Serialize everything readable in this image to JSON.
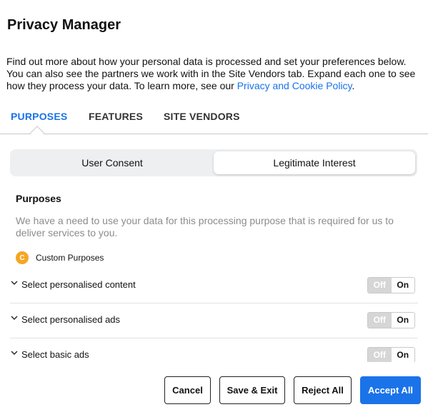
{
  "modal": {
    "title": "Privacy Manager",
    "intro_text": "Find out more about how your personal data is processed and set your preferences below. You can also see the partners we work with in the Site Vendors tab. Expand each one to see how they process your data. To learn more, see our ",
    "intro_link": "Privacy and Cookie Policy",
    "intro_end": "."
  },
  "tabs": [
    {
      "label": "PURPOSES",
      "active": true
    },
    {
      "label": "FEATURES",
      "active": false
    },
    {
      "label": "SITE VENDORS",
      "active": false
    }
  ],
  "consent_toggle": {
    "left": "User Consent",
    "right": "Legitimate Interest",
    "selected": "Legitimate Interest"
  },
  "section": {
    "title": "Purposes",
    "description": "We have a need to use your data for this processing purpose that is required for us to deliver services to you.",
    "custom_badge": "C",
    "custom_label": "Custom Purposes"
  },
  "purposes": [
    {
      "label": "Select personalised content",
      "off": "Off",
      "on": "On",
      "state": "On"
    },
    {
      "label": "Select personalised ads",
      "off": "Off",
      "on": "On",
      "state": "On"
    },
    {
      "label": "Select basic ads",
      "off": "Off",
      "on": "On",
      "state": "On"
    }
  ],
  "footer": {
    "cancel": "Cancel",
    "save_exit": "Save & Exit",
    "reject_all": "Reject All",
    "accept_all": "Accept All"
  },
  "colors": {
    "accent": "#1a73e8",
    "badge": "#f5a623"
  }
}
